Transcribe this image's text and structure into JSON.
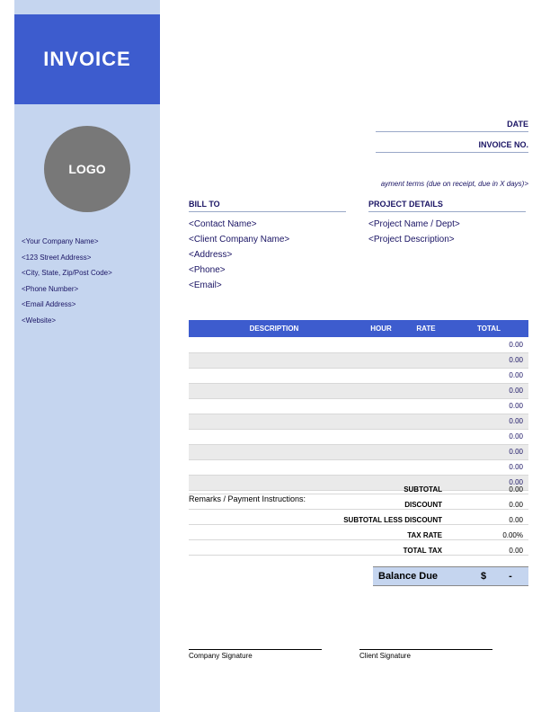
{
  "title": "INVOICE",
  "logo_text": "LOGO",
  "company": {
    "name": "<Your Company Name>",
    "address": "<123 Street Address>",
    "city": "<City, State, Zip/Post Code>",
    "phone": "<Phone Number>",
    "email": "<Email Address>",
    "website": "<Website>"
  },
  "meta": {
    "date_label": "DATE",
    "invoice_no_label": "INVOICE NO."
  },
  "payment_terms": "ayment terms (due on receipt, due in X days)>",
  "bill_to": {
    "heading": "BILL TO",
    "contact": "<Contact Name>",
    "company": "<Client Company Name>",
    "address": "<Address>",
    "phone": "<Phone>",
    "email": "<Email>"
  },
  "project": {
    "heading": "PROJECT DETAILS",
    "name": "<Project Name / Dept>",
    "description": "<Project Description>"
  },
  "table": {
    "headers": {
      "description": "DESCRIPTION",
      "hour": "HOUR",
      "rate": "RATE",
      "total": "TOTAL"
    },
    "rows": [
      {
        "d": "",
        "h": "",
        "r": "",
        "t": "0.00"
      },
      {
        "d": "",
        "h": "",
        "r": "",
        "t": "0.00"
      },
      {
        "d": "",
        "h": "",
        "r": "",
        "t": "0.00"
      },
      {
        "d": "",
        "h": "",
        "r": "",
        "t": "0.00"
      },
      {
        "d": "",
        "h": "",
        "r": "",
        "t": "0.00"
      },
      {
        "d": "",
        "h": "",
        "r": "",
        "t": "0.00"
      },
      {
        "d": "",
        "h": "",
        "r": "",
        "t": "0.00"
      },
      {
        "d": "",
        "h": "",
        "r": "",
        "t": "0.00"
      },
      {
        "d": "",
        "h": "",
        "r": "",
        "t": "0.00"
      },
      {
        "d": "",
        "h": "",
        "r": "",
        "t": "0.00"
      }
    ]
  },
  "remarks_label": "Remarks / Payment Instructions:",
  "summary": {
    "subtotal": {
      "label": "SUBTOTAL",
      "value": "0.00"
    },
    "discount": {
      "label": "DISCOUNT",
      "value": "0.00"
    },
    "less": {
      "label": "SUBTOTAL LESS DISCOUNT",
      "value": "0.00"
    },
    "tax_rate": {
      "label": "TAX RATE",
      "value": "0.00%"
    },
    "total_tax": {
      "label": "TOTAL TAX",
      "value": "0.00"
    }
  },
  "balance": {
    "label": "Balance Due",
    "currency": "$",
    "value": "-"
  },
  "signatures": {
    "company": "Company Signature",
    "client": "Client Signature"
  }
}
